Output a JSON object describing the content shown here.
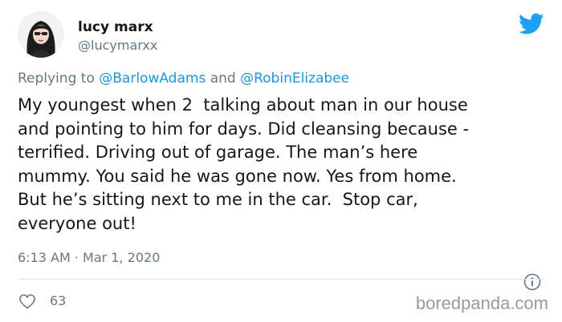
{
  "author": {
    "display_name": "lucy marx",
    "handle": "@lucymarxx"
  },
  "reply": {
    "prefix": "Replying to",
    "mention_1": "@BarlowAdams",
    "joiner": "and",
    "mention_2": "@RobinElizabee"
  },
  "tweet": {
    "text": "My youngest when 2  talking about man in our house\nand pointing to him for days. Did cleansing because -\nterrified. Driving out of garage. The man’s here\nmummy. You said he was gone now. Yes from home.\nBut he’s sitting next to me in the car.  Stop car,\neveryone out!",
    "timestamp": "6:13 AM · Mar 1, 2020"
  },
  "stats": {
    "likes": "63"
  },
  "watermark": "boredpanda.com",
  "icons": {
    "brand": "twitter-bird-icon",
    "info": "info-icon",
    "like": "heart-icon"
  },
  "colors": {
    "brand_blue": "#1da1f2",
    "mention_blue": "#1b95e0",
    "muted_gray": "#657786",
    "text_dark": "#14171a"
  }
}
